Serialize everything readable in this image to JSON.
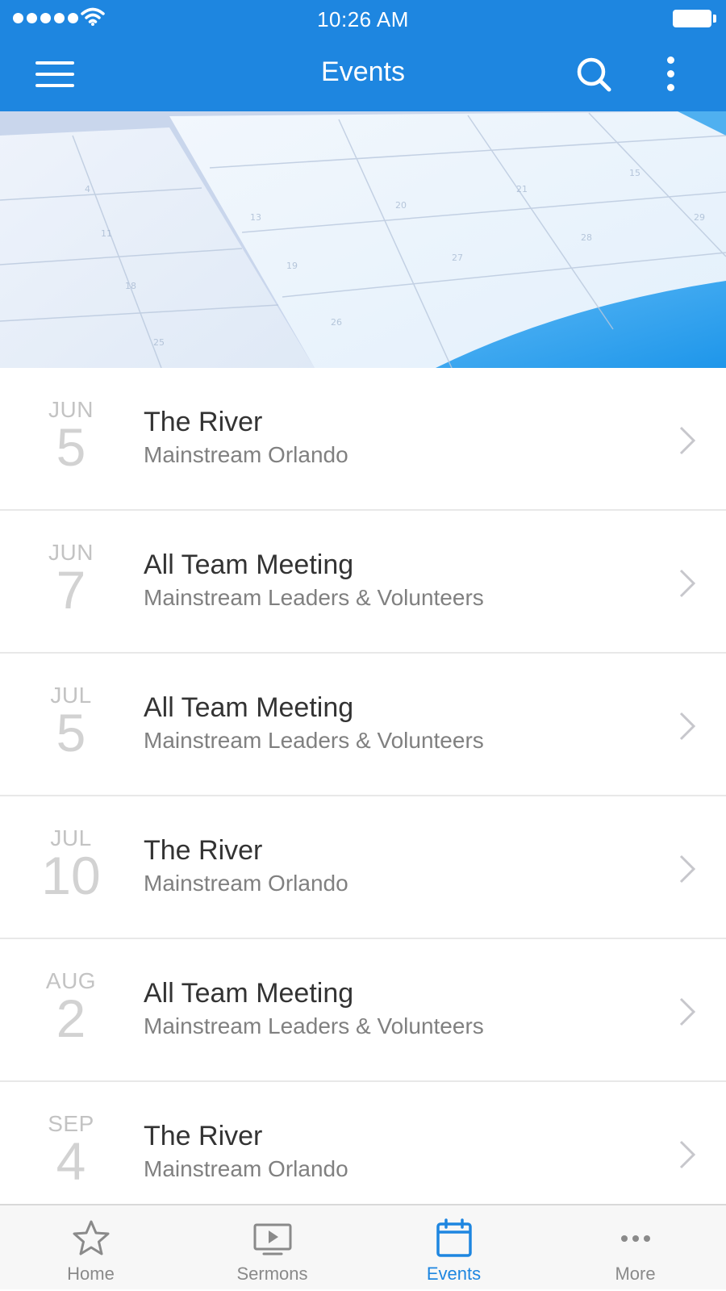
{
  "status_bar": {
    "time": "10:26 AM"
  },
  "nav": {
    "title": "Events"
  },
  "events": [
    {
      "month": "JUN",
      "day": "5",
      "title": "The River",
      "subtitle": "Mainstream Orlando"
    },
    {
      "month": "JUN",
      "day": "7",
      "title": "All Team Meeting",
      "subtitle": "Mainstream Leaders & Volunteers"
    },
    {
      "month": "JUL",
      "day": "5",
      "title": "All Team Meeting",
      "subtitle": "Mainstream Leaders & Volunteers"
    },
    {
      "month": "JUL",
      "day": "10",
      "title": "The River",
      "subtitle": "Mainstream Orlando"
    },
    {
      "month": "AUG",
      "day": "2",
      "title": "All Team Meeting",
      "subtitle": "Mainstream Leaders & Volunteers"
    },
    {
      "month": "SEP",
      "day": "4",
      "title": "The River",
      "subtitle": "Mainstream Orlando"
    }
  ],
  "tabs": [
    {
      "label": "Home",
      "icon": "star-icon"
    },
    {
      "label": "Sermons",
      "icon": "tv-play-icon"
    },
    {
      "label": "Events",
      "icon": "calendar-icon",
      "active": true
    },
    {
      "label": "More",
      "icon": "more-dots-icon"
    }
  ],
  "colors": {
    "primary": "#1e86e0",
    "title_text": "#333333",
    "subtitle_text": "#808080",
    "date_text": "#c3c3c3",
    "tab_inactive": "#8a8a8a"
  }
}
